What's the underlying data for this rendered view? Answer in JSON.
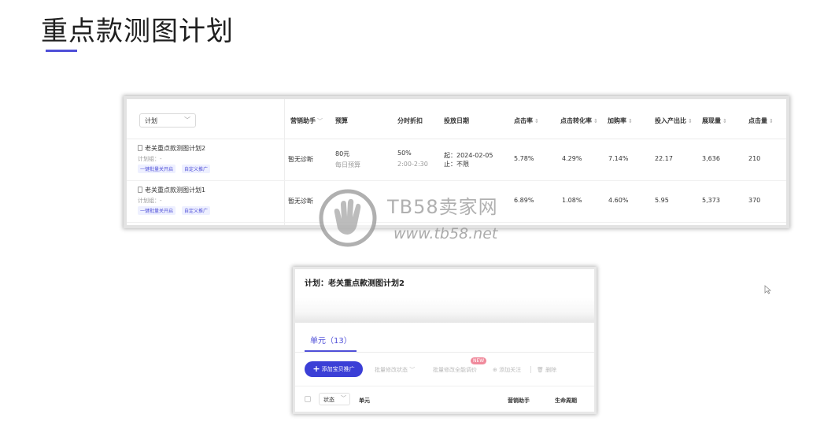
{
  "slide": {
    "title": "重点款测图计划",
    "accent_color": "#4f4fd8"
  },
  "plan_table": {
    "plan_select_label": "计划",
    "headers": {
      "assistant": "营销助手",
      "budget": "预算",
      "time_discount": "分时折扣",
      "delivery_date": "投放日期",
      "ctr": "点击率",
      "cvr": "点击转化率",
      "cart_rate": "加购率",
      "roi": "投入产出比",
      "impressions": "展现量",
      "clicks": "点击量"
    },
    "rows": [
      {
        "name": "老关重点款测图计划2",
        "group": "计划组：-",
        "tag1": "一键批量关开启",
        "tag2": "自定义推广",
        "assistant": "暂无诊断",
        "budget": "80元",
        "budget_sub": "每日预算",
        "discount": "50%",
        "discount_sub": "2:00-2:30",
        "start_date": "起：2024-02-05",
        "end_date": "止：不限",
        "ctr": "5.78%",
        "cvr": "4.29%",
        "cart_rate": "7.14%",
        "roi": "22.17",
        "impressions": "3,636",
        "clicks": "210"
      },
      {
        "name": "老关重点款测图计划1",
        "group": "计划组：-",
        "tag1": "一键批量关开启",
        "tag2": "自定义推广",
        "assistant": "暂无诊断",
        "ctr": "6.89%",
        "cvr": "1.08%",
        "cart_rate": "4.60%",
        "roi": "5.95",
        "impressions": "5,373",
        "clicks": "370"
      }
    ]
  },
  "watermark": {
    "brand": "TB58卖家网",
    "url": "www.tb58.net"
  },
  "unit_panel": {
    "title": "计划：老关重点款测图计划2",
    "tab_label": "单元（13）",
    "add_button": "添加宝贝推广",
    "batch_status": "批量修改状态",
    "batch_smart": "批量修改全能调价",
    "new_badge": "NEW",
    "add_follow": "添加关注",
    "delete": "删除",
    "status_select": "状态",
    "col_unit": "单元",
    "col_assistant": "营销助手",
    "col_lifecycle": "生命周期",
    "button_color": "#3b3fd6"
  }
}
